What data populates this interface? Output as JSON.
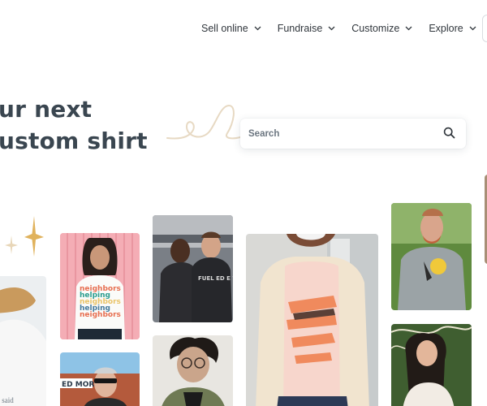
{
  "nav": {
    "items": [
      {
        "label": "Sell online"
      },
      {
        "label": "Fundraise"
      },
      {
        "label": "Customize"
      },
      {
        "label": "Explore"
      }
    ]
  },
  "hero": {
    "line1": "ur next",
    "line2": "ustom shirt"
  },
  "search": {
    "placeholder": "Search"
  },
  "photos": {
    "shirt1": [
      "neighbors",
      "helping",
      "neighbors",
      "helping",
      "neighbors"
    ],
    "shirt2": "FUEL ED E WATER",
    "banner": "ED MORE",
    "fragment": "e said"
  },
  "colors": {
    "accent_gold": "#e0b25c",
    "nav_text": "#30363c",
    "headline": "#3a4650",
    "squiggle": "#e7d9c3"
  }
}
